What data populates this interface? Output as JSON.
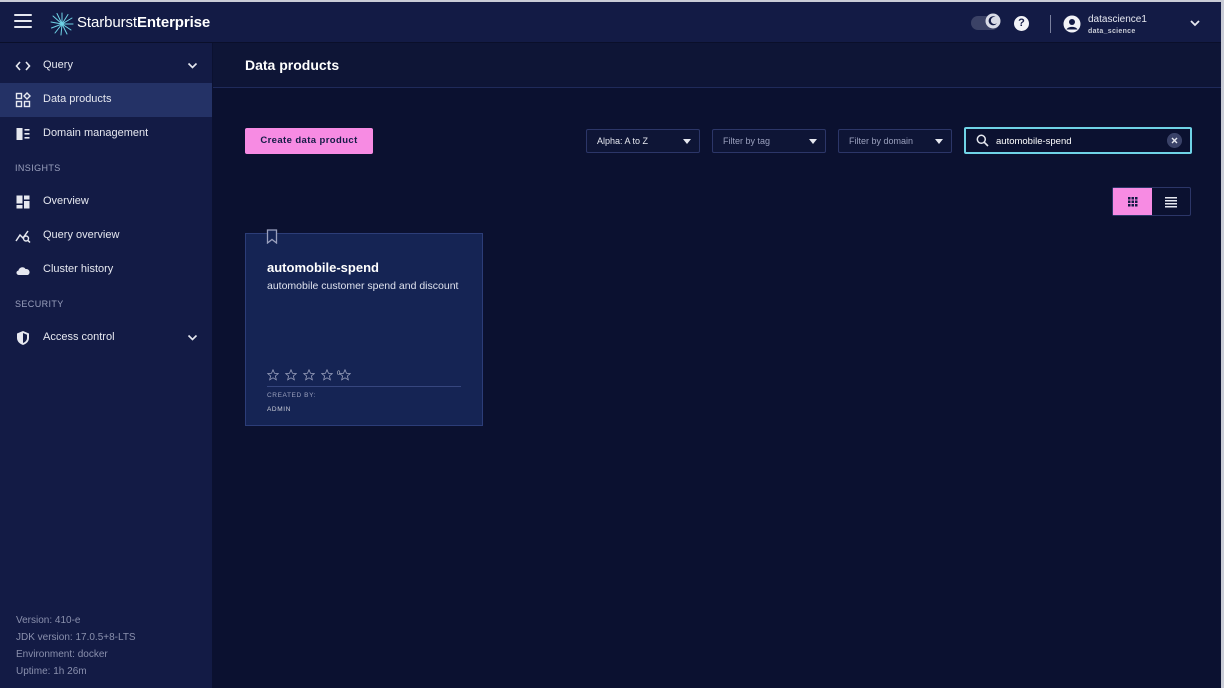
{
  "app": {
    "brand_light": "Starburst",
    "brand_bold": "Enterprise",
    "help_glyph": "?",
    "user_name": "datascience1",
    "user_role": "data_science"
  },
  "sidebar": {
    "items": [
      {
        "label": "Query",
        "icon": "code-brackets-icon",
        "expandable": true
      },
      {
        "label": "Data products",
        "icon": "data-products-icon",
        "active": true
      },
      {
        "label": "Domain management",
        "icon": "domain-management-icon"
      }
    ],
    "insights_label": "INSIGHTS",
    "insights_items": [
      {
        "label": "Overview",
        "icon": "dashboard-icon"
      },
      {
        "label": "Query overview",
        "icon": "query-chart-icon"
      },
      {
        "label": "Cluster history",
        "icon": "cloud-icon"
      }
    ],
    "security_label": "SECURITY",
    "security_items": [
      {
        "label": "Access control",
        "icon": "shield-icon",
        "expandable": true
      }
    ],
    "footer": {
      "version": "Version: 410-e",
      "jdk": "JDK version: 17.0.5+8-LTS",
      "environment": "Environment: docker",
      "uptime": "Uptime: 1h 26m"
    }
  },
  "main": {
    "title": "Data products",
    "create_button": "Create data product",
    "sort_select": "Alpha: A to Z",
    "tag_filter_placeholder": "Filter by tag",
    "domain_filter_placeholder": "Filter by domain",
    "search_value": "automobile-spend",
    "view_mode": "grid",
    "cards": [
      {
        "title": "automobile-spend",
        "description": "automobile customer spend and discount",
        "rating": 0,
        "rating_count": "0",
        "created_by_label": "CREATED BY:",
        "created_by": "ADMIN"
      }
    ]
  },
  "colors": {
    "accent": "#f78be3",
    "topbar": "#131b45",
    "sidebar": "#131b45",
    "active_item": "#243266",
    "background": "#0b1130",
    "card": "#152454",
    "search_border": "#6fd3e6"
  }
}
